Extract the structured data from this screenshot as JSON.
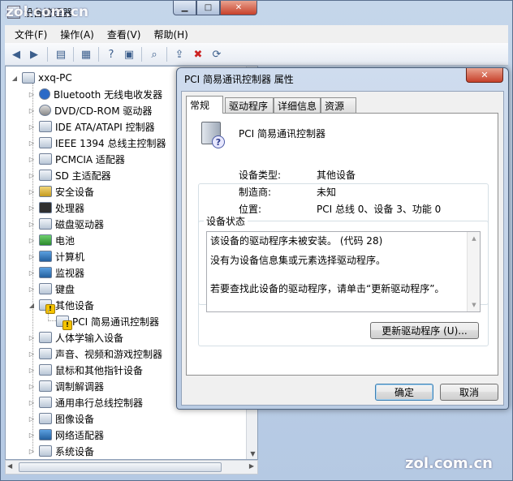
{
  "watermark": {
    "top": "zol.com.cn",
    "bottom": "zol.com.cn"
  },
  "window": {
    "title": "设备管理器",
    "menu": [
      "文件(F)",
      "操作(A)",
      "查看(V)",
      "帮助(H)"
    ]
  },
  "tree": {
    "root": "xxq-PC",
    "items": [
      {
        "label": "Bluetooth 无线电收发器",
        "icon": "bluetooth-icon"
      },
      {
        "label": "DVD/CD-ROM 驱动器",
        "icon": "optical-drive-icon"
      },
      {
        "label": "IDE ATA/ATAPI 控制器",
        "icon": "ide-controller-icon"
      },
      {
        "label": "IEEE 1394 总线主控制器",
        "icon": "firewire-icon"
      },
      {
        "label": "PCMCIA 适配器",
        "icon": "pcmcia-icon"
      },
      {
        "label": "SD 主适配器",
        "icon": "sd-host-icon"
      },
      {
        "label": "安全设备",
        "icon": "security-device-icon"
      },
      {
        "label": "处理器",
        "icon": "processor-icon"
      },
      {
        "label": "磁盘驱动器",
        "icon": "disk-drive-icon"
      },
      {
        "label": "电池",
        "icon": "battery-icon"
      },
      {
        "label": "计算机",
        "icon": "computer-icon"
      },
      {
        "label": "监视器",
        "icon": "monitor-icon"
      },
      {
        "label": "键盘",
        "icon": "keyboard-icon"
      },
      {
        "label": "其他设备",
        "icon": "other-devices-icon"
      },
      {
        "label": "PCI 简易通讯控制器",
        "icon": "pci-device-warning-icon"
      },
      {
        "label": "人体学输入设备",
        "icon": "hid-icon"
      },
      {
        "label": "声音、视频和游戏控制器",
        "icon": "sound-icon"
      },
      {
        "label": "鼠标和其他指针设备",
        "icon": "mouse-icon"
      },
      {
        "label": "调制解调器",
        "icon": "modem-icon"
      },
      {
        "label": "通用串行总线控制器",
        "icon": "usb-icon"
      },
      {
        "label": "图像设备",
        "icon": "imaging-device-icon"
      },
      {
        "label": "网络适配器",
        "icon": "network-adapter-icon"
      },
      {
        "label": "系统设备",
        "icon": "system-device-icon"
      }
    ]
  },
  "dialog": {
    "title": "PCI 简易通讯控制器 属性",
    "tabs": [
      "常规",
      "驱动程序",
      "详细信息",
      "资源"
    ],
    "device_name": "PCI 简易通讯控制器",
    "props": {
      "type_label": "设备类型:",
      "type_value": "其他设备",
      "mfr_label": "制造商:",
      "mfr_value": "未知",
      "loc_label": "位置:",
      "loc_value": "PCI 总线 0、设备 3、功能 0"
    },
    "status": {
      "legend": "设备状态",
      "line1": "该设备的驱动程序未被安装。 (代码 28)",
      "line2": "没有为设备信息集或元素选择驱动程序。",
      "line3": "若要查找此设备的驱动程序，请单击“更新驱动程序”。"
    },
    "update_button": "更新驱动程序 (U)...",
    "ok_button": "确定",
    "cancel_button": "取消"
  }
}
